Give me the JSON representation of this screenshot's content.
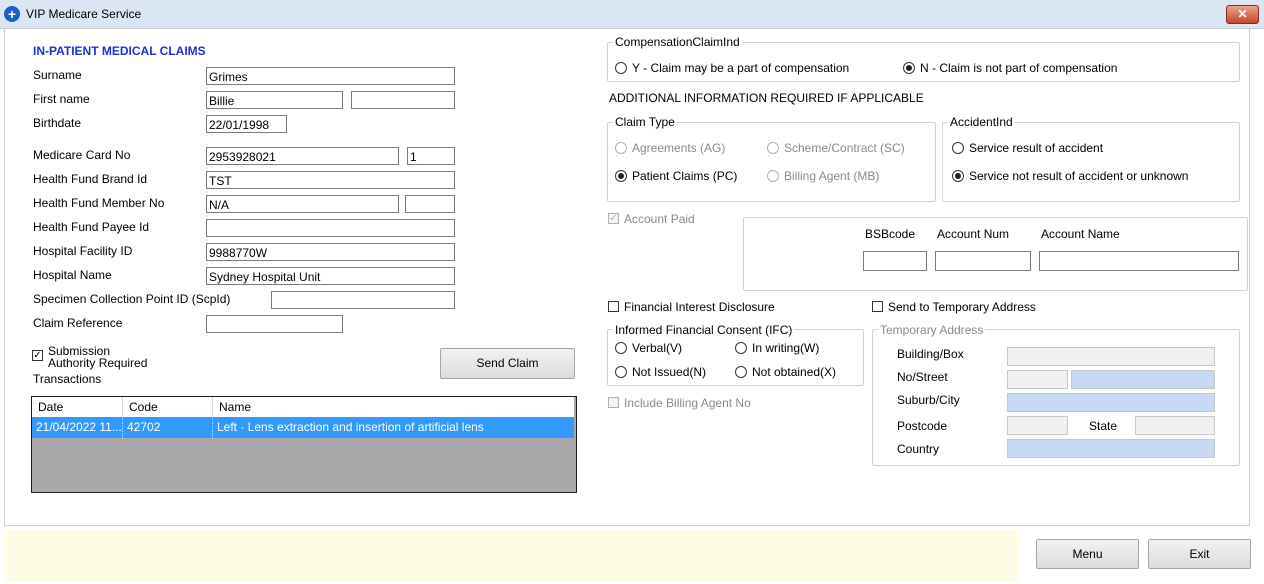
{
  "window": {
    "title": "VIP Medicare Service",
    "close_glyph": "✕"
  },
  "left": {
    "section_title": "IN-PATIENT MEDICAL CLAIMS",
    "labels": {
      "surname": "Surname",
      "first_name": "First name",
      "birthdate": "Birthdate",
      "medicare_card": "Medicare Card No",
      "hf_brand": "Health Fund Brand Id",
      "hf_member": "Health Fund Member No",
      "hf_payee": "Health Fund Payee Id",
      "hospital_facility": "Hospital Facility ID",
      "hospital_name": "Hospital Name",
      "specimen": "Specimen Collection Point ID (ScpId)",
      "claim_ref": "Claim Reference"
    },
    "values": {
      "surname": "Grimes",
      "first_name": "Billie",
      "first_name_2": "",
      "birthdate": "22/01/1998",
      "medicare_card": "2953928021",
      "medicare_irn": "1",
      "hf_brand": "TST",
      "hf_member": "N/A",
      "hf_member_2": "",
      "hf_payee": "",
      "hospital_facility": "9988770W",
      "hospital_name": "Sydney Hospital Unit",
      "specimen": "",
      "claim_ref": ""
    },
    "submission_label_1": "Submission",
    "submission_label_2": "Authority Required",
    "submission_checked": true,
    "send_claim": "Send Claim",
    "transactions_label": "Transactions",
    "grid": {
      "columns": [
        "Date",
        "Code",
        "Name"
      ],
      "rows": [
        {
          "date": "21/04/2022 11...",
          "code": "42702",
          "name": "Left - Lens extraction and insertion of artificial lens"
        }
      ]
    }
  },
  "right": {
    "comp_group": "CompensationClaimInd",
    "comp_y": "Y - Claim may be a part of compensation",
    "comp_n": "N - Claim is not part of compensation",
    "additional_info": "ADDITIONAL INFORMATION REQUIRED IF APPLICABLE",
    "claim_type_group": "Claim Type",
    "ct_ag": "Agreements (AG)",
    "ct_sc": "Scheme/Contract (SC)",
    "ct_pc": "Patient Claims (PC)",
    "ct_mb": "Billing Agent (MB)",
    "accident_group": "AccidentInd",
    "acc_yes": "Service result of accident",
    "acc_no": "Service not result of accident or unknown",
    "account_paid": "Account Paid",
    "bsb_label": "BSBcode",
    "acct_num_label": "Account Num",
    "acct_name_label": "Account Name",
    "fin_interest": "Financial Interest Disclosure",
    "send_temp": "Send to Temporary Address",
    "ifc_group": "Informed Financial Consent (IFC)",
    "ifc_verbal": "Verbal(V)",
    "ifc_writing": "In writing(W)",
    "ifc_not_issued": "Not Issued(N)",
    "ifc_not_obtained": "Not obtained(X)",
    "include_billing": "Include Billing Agent No",
    "temp_group": "Temporary Address",
    "building": "Building/Box",
    "street": "No/Street",
    "suburb": "Suburb/City",
    "postcode": "Postcode",
    "state": "State",
    "country": "Country"
  },
  "footer": {
    "menu": "Menu",
    "exit": "Exit"
  }
}
